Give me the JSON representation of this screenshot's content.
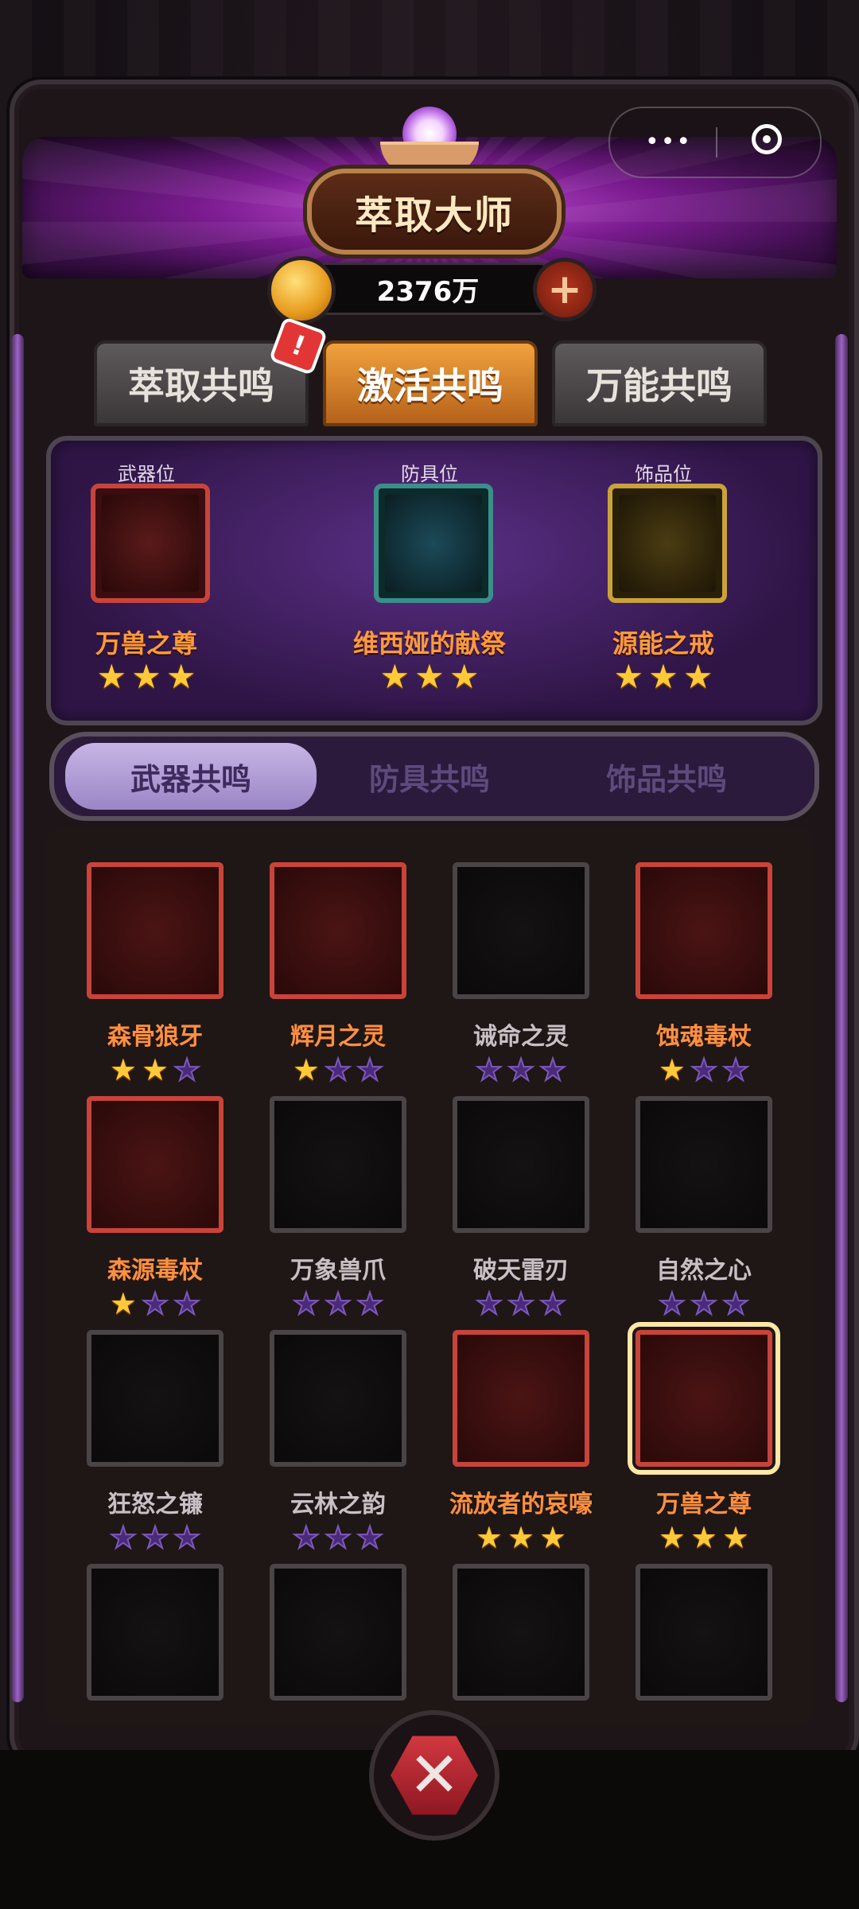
{
  "header": {
    "title": "萃取大师",
    "currency_amount": "2376万",
    "capsule_more_icon": "more-dots-icon",
    "capsule_close_icon": "target-close-icon"
  },
  "top_tabs": [
    {
      "label": "萃取共鸣",
      "active": false,
      "has_alert": true
    },
    {
      "label": "激活共鸣",
      "active": true,
      "has_alert": false
    },
    {
      "label": "万能共鸣",
      "active": false,
      "has_alert": false
    }
  ],
  "alert_badge": "!",
  "equipped_slots": [
    {
      "slot_label": "武器位",
      "item_name": "万兽之尊",
      "stars": 3,
      "rarity_color": "#c8443a"
    },
    {
      "slot_label": "防具位",
      "item_name": "维西娅的献祭",
      "stars": 3,
      "rarity_color": "#3a8f8a"
    },
    {
      "slot_label": "饰品位",
      "item_name": "源能之戒",
      "stars": 3,
      "rarity_color": "#caa23a"
    }
  ],
  "category_tabs": [
    {
      "label": "武器共鸣",
      "active": true
    },
    {
      "label": "防具共鸣",
      "active": false
    },
    {
      "label": "饰品共鸣",
      "active": false
    }
  ],
  "items": [
    {
      "name": "森骨狼牙",
      "stars": 2,
      "rarity": "red",
      "selected": false
    },
    {
      "name": "辉月之灵",
      "stars": 1,
      "rarity": "red",
      "selected": false
    },
    {
      "name": "诫命之灵",
      "stars": 0,
      "rarity": "gray",
      "selected": false
    },
    {
      "name": "蚀魂毒杖",
      "stars": 1,
      "rarity": "red",
      "selected": false
    },
    {
      "name": "森源毒杖",
      "stars": 1,
      "rarity": "red",
      "selected": false
    },
    {
      "name": "万象兽爪",
      "stars": 0,
      "rarity": "gray",
      "selected": false
    },
    {
      "name": "破天雷刃",
      "stars": 0,
      "rarity": "gray",
      "selected": false
    },
    {
      "name": "自然之心",
      "stars": 0,
      "rarity": "gray",
      "selected": false
    },
    {
      "name": "狂怒之镰",
      "stars": 0,
      "rarity": "gray",
      "selected": false
    },
    {
      "name": "云林之韵",
      "stars": 0,
      "rarity": "gray",
      "selected": false
    },
    {
      "name": "流放者的哀嚎",
      "stars": 3,
      "rarity": "red",
      "selected": false
    },
    {
      "name": "万兽之尊",
      "stars": 3,
      "rarity": "red",
      "selected": true
    },
    {
      "name": "",
      "stars": 0,
      "rarity": "gray",
      "selected": false
    },
    {
      "name": "",
      "stars": 0,
      "rarity": "gray",
      "selected": false
    },
    {
      "name": "",
      "stars": 0,
      "rarity": "gray",
      "selected": false
    },
    {
      "name": "",
      "stars": 0,
      "rarity": "gray",
      "selected": false
    }
  ],
  "colors": {
    "accent_orange": "#ff9040",
    "star_gold": "#ffc93a",
    "star_empty": "#4a2a7a",
    "rare_frame": "#c8443a"
  },
  "footer": {
    "emblem_icon": "crossed-swords-emblem-icon"
  }
}
